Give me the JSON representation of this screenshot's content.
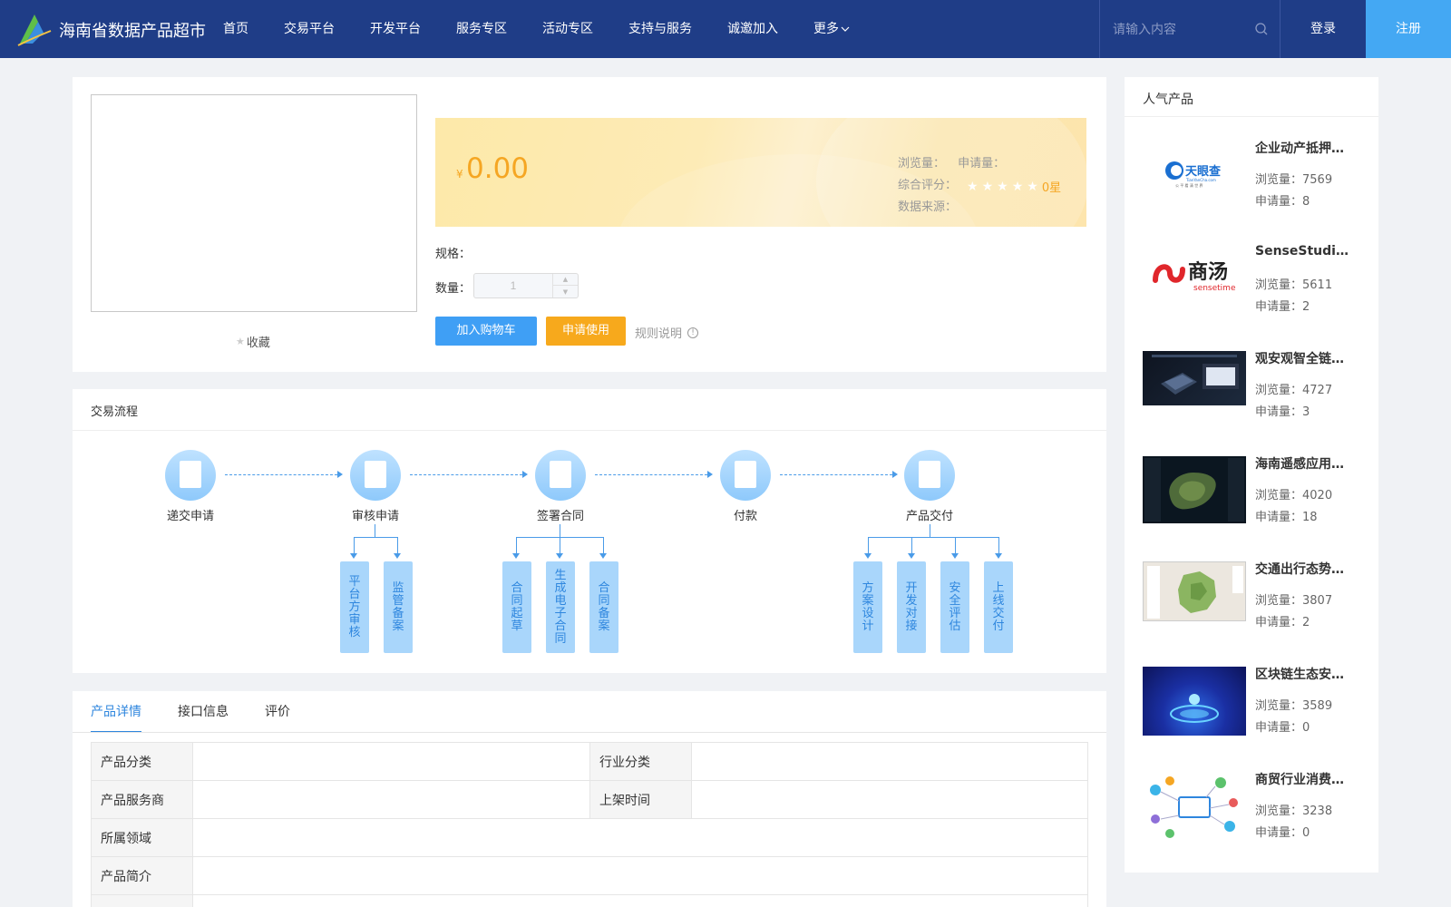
{
  "header": {
    "site_title": "海南省数据产品超市",
    "nav": [
      "首页",
      "交易平台",
      "开发平台",
      "服务专区",
      "活动专区",
      "支持与服务",
      "诚邀加入",
      "更多"
    ],
    "search_placeholder": "请输入内容",
    "login": "登录",
    "register": "注册"
  },
  "product": {
    "favorite": "收藏",
    "currency": "¥",
    "price": "0.00",
    "views_label": "浏览量：",
    "applications_label": "申请量：",
    "rating_label": "综合评分：",
    "rating_text": "0星",
    "rating_value": 0,
    "rating_max": 5,
    "source_label": "数据来源：",
    "spec_label": "规格：",
    "qty_label": "数量：",
    "qty_value": "1",
    "add_to_cart": "加入购物车",
    "apply": "申请使用",
    "rules": "规则说明"
  },
  "flow": {
    "title": "交易流程",
    "steps": [
      "递交申请",
      "审核申请",
      "签署合同",
      "付款",
      "产品交付"
    ],
    "substeps": {
      "review": [
        "平台方审核",
        "监管备案"
      ],
      "contract": [
        "合同起草",
        "生成电子合同",
        "合同备案"
      ],
      "delivery": [
        "方案设计",
        "开发对接",
        "安全评估",
        "上线交付"
      ]
    }
  },
  "details": {
    "tabs": [
      "产品详情",
      "接口信息",
      "评价"
    ],
    "rows": {
      "category": "产品分类",
      "industry": "行业分类",
      "provider": "产品服务商",
      "listed": "上架时间",
      "domain": "所属领域",
      "intro": "产品简介"
    }
  },
  "popular": {
    "title": "人气产品",
    "items": [
      {
        "name": "企业动产抵押…",
        "views": "浏览量：7569",
        "apps": "申请量：8"
      },
      {
        "name": "SenseStudio…",
        "views": "浏览量：5611",
        "apps": "申请量：2"
      },
      {
        "name": "观安观智全链…",
        "views": "浏览量：4727",
        "apps": "申请量：3"
      },
      {
        "name": "海南遥感应用…",
        "views": "浏览量：4020",
        "apps": "申请量：18"
      },
      {
        "name": "交通出行态势…",
        "views": "浏览量：3807",
        "apps": "申请量：2"
      },
      {
        "name": "区块链生态安…",
        "views": "浏览量：3589",
        "apps": "申请量：0"
      },
      {
        "name": "商贸行业消费…",
        "views": "浏览量：3238",
        "apps": "申请量：0"
      }
    ],
    "thumb_logos": {
      "tianyancha": "天眼查",
      "tianyancha_url": "TianYanCha.com",
      "tianyancha_sub": "公 平 看 清 世 界",
      "sensetime_cn": "商汤",
      "sensetime_en": "sensetime"
    }
  },
  "colors": {
    "header_bg": "#1f3d87",
    "accent_blue": "#3f9ff5",
    "accent_orange": "#f7a91c",
    "price": "#f5a623"
  }
}
